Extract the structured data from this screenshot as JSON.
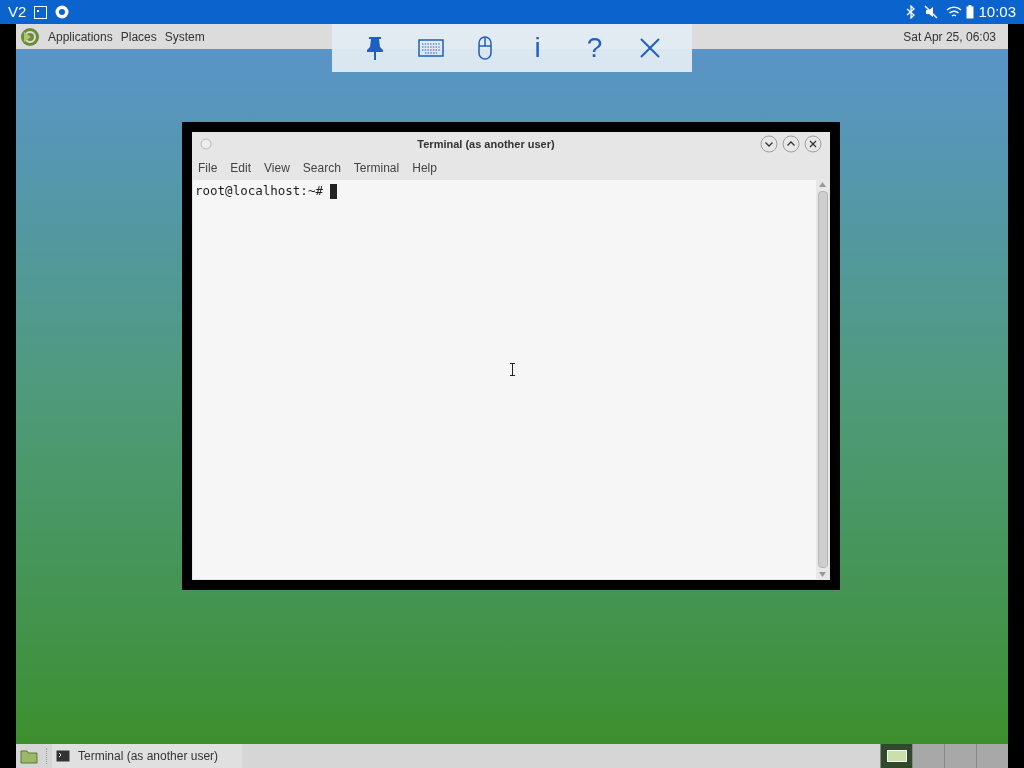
{
  "status_bar": {
    "left_text": "V2",
    "time": "10:03"
  },
  "top_panel": {
    "menus": [
      "Applications",
      "Places",
      "System"
    ],
    "clock": "Sat Apr 25, 06:03"
  },
  "remote_toolbar": {
    "buttons": [
      {
        "kind": "pin"
      },
      {
        "kind": "keyboard"
      },
      {
        "kind": "mouse"
      },
      {
        "kind": "info",
        "label": "i"
      },
      {
        "kind": "help",
        "label": "?"
      },
      {
        "kind": "close"
      }
    ]
  },
  "terminal_window": {
    "title": "Terminal (as another user)",
    "menus": [
      "File",
      "Edit",
      "View",
      "Search",
      "Terminal",
      "Help"
    ],
    "lines": [
      "root@localhost:~#"
    ]
  },
  "bottom_panel": {
    "tasks": [
      {
        "label": "Terminal (as another user)"
      }
    ],
    "workspaces": [
      {
        "selected": true
      },
      {
        "selected": false
      },
      {
        "selected": false
      },
      {
        "selected": false
      }
    ]
  }
}
